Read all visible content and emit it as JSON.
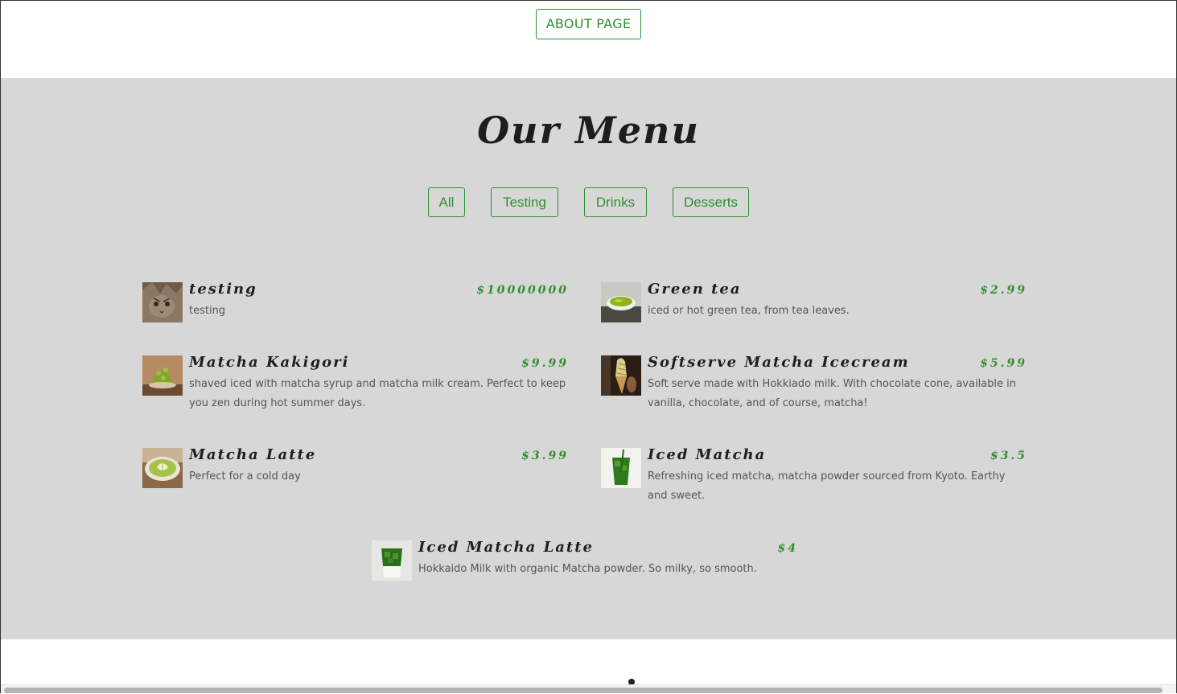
{
  "header": {
    "about_label": "ABOUT PAGE"
  },
  "menu": {
    "title": "Our Menu",
    "filters": [
      "All",
      "Testing",
      "Drinks",
      "Desserts"
    ],
    "items": [
      {
        "name": "testing",
        "price": "$10000000",
        "desc": "testing",
        "thumb": "cat-photo"
      },
      {
        "name": "Green tea",
        "price": "$2.99",
        "desc": "iced or hot green tea, from tea leaves.",
        "thumb": "green-tea-cup"
      },
      {
        "name": "Matcha Kakigori",
        "price": "$9.99",
        "desc": "shaved iced with matcha syrup and matcha milk cream. Perfect to keep you zen during hot summer days.",
        "thumb": "kakigori"
      },
      {
        "name": "Softserve Matcha Icecream",
        "price": "$5.99",
        "desc": "Soft serve made with Hokkiado milk. With chocolate cone, available in vanilla, chocolate, and of course, matcha!",
        "thumb": "softserve-cone"
      },
      {
        "name": "Matcha Latte",
        "price": "$3.99",
        "desc": "Perfect for a cold day",
        "thumb": "latte-cup"
      },
      {
        "name": "Iced Matcha",
        "price": "$3.5",
        "desc": "Refreshing iced matcha, matcha powder sourced from Kyoto. Earthy and sweet.",
        "thumb": "iced-matcha-glass"
      },
      {
        "name": "Iced Matcha Latte",
        "price": "$4",
        "desc": "Hokkaido Milk with organic Matcha powder. So milky, so smooth.",
        "thumb": "iced-latte-glass"
      }
    ]
  },
  "colors": {
    "accent": "#2f8f2f",
    "section_bg": "#d7d7d7",
    "text_dark": "#1e1e1e",
    "text_muted": "#555555"
  }
}
